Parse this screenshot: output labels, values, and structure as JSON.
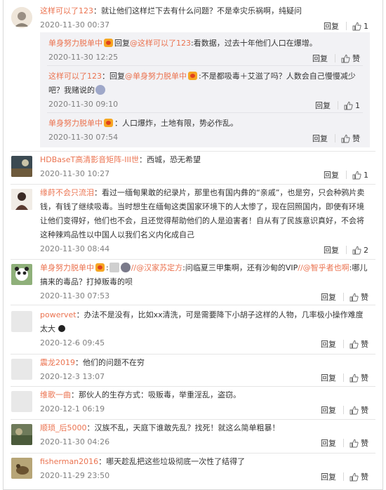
{
  "ui": {
    "reply_label": "回复",
    "like_label": "赞",
    "reply_prefix": "回复",
    "colon": ":"
  },
  "comments": [
    {
      "user": "这样可以了123",
      "text": "：就让他们这样烂下去有什么问题？不是幸灾乐祸啊，纯疑问",
      "time": "2020-11-30 00:37",
      "likes": "1",
      "replies": [
        {
          "user": "单身努力脱单中",
          "reply_to": "@这样可以了123",
          "text": ":看数据，过去十年他们人口在爆增。",
          "time": "2020-11-30 12:25",
          "likes": "赞"
        },
        {
          "user": "这样可以了123",
          "reply_to": "@单身努力脱单中",
          "text": ":不是都吸毒＋艾滋了吗？人数会自己慢慢减少吧？我赌说的",
          "time": "2020-11-30 09:10",
          "likes": "1"
        },
        {
          "user": "单身努力脱单中",
          "text": "：人口爆炸，土地有限，势必作乱。",
          "time": "2020-11-30 07:54",
          "likes": "赞"
        }
      ]
    },
    {
      "user": "HDBaseT高清影音矩阵-III世",
      "text": "：西城，恐无希望",
      "time": "2020-11-30 10:27",
      "likes": "1"
    },
    {
      "user": "缘莳不会只流泪",
      "text": "：看过一缅甸果敢的纪录片，那里也有国内彝的“亲戚”，也是穷，只会种鸦片卖钱，有钱了继续吸毒。当时想生在缅甸这类国家环境下的人太惨了，现在回照国内，即使有环境让他们变得好，他们也不会，且还觉得帮助他们的人是迫害者！自从有了民族意识真好，不会将这种辣鸡品性以中国人以我们名义内化成自己",
      "time": "2020-11-30 08:44",
      "likes": "2"
    },
    {
      "user": "单身努力脱单中",
      "mention1": "//@汉家苏定方",
      "text1": ":问临夏三甲集啊，还有沙甸的VIP",
      "mention2": "//@智乎者也啊",
      "text2": ":哪儿搞来的毒品？打掉贩毒的呗",
      "time": "2020-11-30 07:53",
      "likes": "赞"
    },
    {
      "user": "powervet",
      "text": "：办法不是没有，比如xx清洗，可是需要降下小胡子这样的人物，几率极小操作难度太大",
      "time": "2020-12-6 09:45",
      "likes": "赞"
    },
    {
      "user": "震龙2019",
      "text": "：他们的问题不在穷",
      "time": "2020-12-3 13:07",
      "likes": "赞"
    },
    {
      "user": "维歌一曲",
      "text": "：那伙人的生存方式：吸贩毒，举重淫乱，盗窃。",
      "time": "2020-12-1 06:19",
      "likes": "赞"
    },
    {
      "user": "顺琐_后5000",
      "text": "：汉族不乱，天庭下谁敢先乱？找死！就这么简单粗暴！",
      "time": "2020-11-30 04:26",
      "likes": "赞"
    },
    {
      "user": "fisherman2016",
      "text": "：哪天趁乱把这些垃圾彻底一次性了结得了",
      "time": "2020-11-29 23:50",
      "likes": "赞"
    }
  ]
}
